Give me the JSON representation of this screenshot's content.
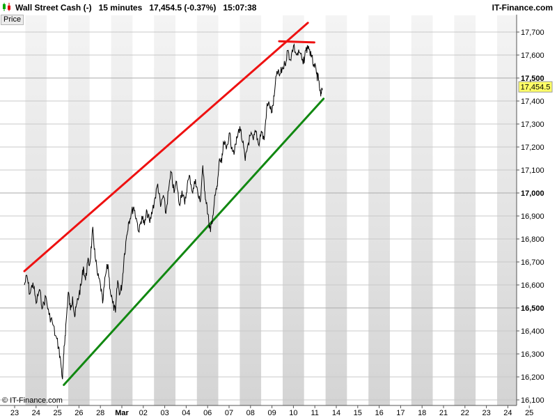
{
  "header": {
    "instrument": "Wall Street Cash (-)",
    "timeframe": "15 minutes",
    "last_change": "17,454.5 (-0.37%)",
    "time": "15:07:38",
    "brand": "IT-Finance.com"
  },
  "panel_label": "Price",
  "copyright": "© IT-Finance.com",
  "last_price_label": "17,454.5",
  "colors": {
    "price_line": "#000000",
    "resistance": "#ee1111",
    "support": "#118811",
    "band_a": "#ffffff",
    "band_b": "#d4d4d4",
    "grid": "#c8c8c8"
  },
  "chart_data": {
    "type": "line",
    "title": "Wall Street Cash (-)",
    "ylim": [
      16100,
      17750
    ],
    "y_ticks": [
      {
        "value": 16100,
        "label": "16,100",
        "bold": false
      },
      {
        "value": 16200,
        "label": "16,200",
        "bold": false
      },
      {
        "value": 16300,
        "label": "16,300",
        "bold": false
      },
      {
        "value": 16400,
        "label": "16,400",
        "bold": false
      },
      {
        "value": 16500,
        "label": "16,500",
        "bold": true
      },
      {
        "value": 16600,
        "label": "16,600",
        "bold": false
      },
      {
        "value": 16700,
        "label": "16,700",
        "bold": false
      },
      {
        "value": 16800,
        "label": "16,800",
        "bold": false
      },
      {
        "value": 16900,
        "label": "16,900",
        "bold": false
      },
      {
        "value": 17000,
        "label": "17,000",
        "bold": true
      },
      {
        "value": 17100,
        "label": "17,100",
        "bold": false
      },
      {
        "value": 17200,
        "label": "17,200",
        "bold": false
      },
      {
        "value": 17300,
        "label": "17,300",
        "bold": false
      },
      {
        "value": 17400,
        "label": "17,400",
        "bold": false
      },
      {
        "value": 17500,
        "label": "17,500",
        "bold": true
      },
      {
        "value": 17600,
        "label": "17,600",
        "bold": false
      },
      {
        "value": 17700,
        "label": "17,700",
        "bold": false
      }
    ],
    "x_ticks": [
      {
        "index": 0,
        "label": "23",
        "bold": false
      },
      {
        "index": 1,
        "label": "24",
        "bold": false
      },
      {
        "index": 2,
        "label": "25",
        "bold": false
      },
      {
        "index": 3,
        "label": "26",
        "bold": false
      },
      {
        "index": 4,
        "label": "28",
        "bold": false
      },
      {
        "index": 5,
        "label": "Mar",
        "bold": true
      },
      {
        "index": 6,
        "label": "02",
        "bold": false
      },
      {
        "index": 7,
        "label": "03",
        "bold": false
      },
      {
        "index": 8,
        "label": "04",
        "bold": false
      },
      {
        "index": 9,
        "label": "06",
        "bold": false
      },
      {
        "index": 10,
        "label": "07",
        "bold": false
      },
      {
        "index": 11,
        "label": "08",
        "bold": false
      },
      {
        "index": 12,
        "label": "09",
        "bold": false
      },
      {
        "index": 13,
        "label": "10",
        "bold": false
      },
      {
        "index": 14,
        "label": "11",
        "bold": false
      },
      {
        "index": 15,
        "label": "14",
        "bold": false
      },
      {
        "index": 16,
        "label": "15",
        "bold": false
      },
      {
        "index": 17,
        "label": "16",
        "bold": false
      },
      {
        "index": 18,
        "label": "17",
        "bold": false
      },
      {
        "index": 19,
        "label": "18",
        "bold": false
      },
      {
        "index": 20,
        "label": "21",
        "bold": false
      },
      {
        "index": 21,
        "label": "22",
        "bold": false
      },
      {
        "index": 22,
        "label": "23",
        "bold": false
      },
      {
        "index": 23,
        "label": "24",
        "bold": false
      },
      {
        "index": 24,
        "label": "25",
        "bold": false
      }
    ],
    "series": [
      {
        "values": [
          [
            0.0,
            16600
          ],
          [
            0.12,
            16640
          ],
          [
            0.25,
            16560
          ],
          [
            0.4,
            16610
          ],
          [
            0.55,
            16520
          ],
          [
            0.7,
            16580
          ],
          [
            0.85,
            16500
          ],
          [
            1.0,
            16550
          ],
          [
            1.15,
            16470
          ],
          [
            1.3,
            16440
          ],
          [
            1.45,
            16380
          ],
          [
            1.6,
            16330
          ],
          [
            1.7,
            16260
          ],
          [
            1.78,
            16190
          ],
          [
            1.84,
            16300
          ],
          [
            1.9,
            16380
          ],
          [
            1.98,
            16480
          ],
          [
            2.05,
            16570
          ],
          [
            2.15,
            16490
          ],
          [
            2.25,
            16550
          ],
          [
            2.35,
            16460
          ],
          [
            2.45,
            16520
          ],
          [
            2.55,
            16560
          ],
          [
            2.65,
            16600
          ],
          [
            2.75,
            16680
          ],
          [
            2.85,
            16620
          ],
          [
            2.95,
            16700
          ],
          [
            3.05,
            16690
          ],
          [
            3.15,
            16800
          ],
          [
            3.2,
            16840
          ],
          [
            3.3,
            16720
          ],
          [
            3.42,
            16640
          ],
          [
            3.55,
            16600
          ],
          [
            3.65,
            16520
          ],
          [
            3.78,
            16640
          ],
          [
            3.9,
            16690
          ],
          [
            4.0,
            16580
          ],
          [
            4.12,
            16520
          ],
          [
            4.25,
            16480
          ],
          [
            4.35,
            16620
          ],
          [
            4.45,
            16560
          ],
          [
            4.55,
            16600
          ],
          [
            4.65,
            16720
          ],
          [
            4.75,
            16800
          ],
          [
            4.85,
            16870
          ],
          [
            4.98,
            16910
          ],
          [
            5.1,
            16940
          ],
          [
            5.22,
            16890
          ],
          [
            5.35,
            16830
          ],
          [
            5.48,
            16900
          ],
          [
            5.6,
            16860
          ],
          [
            5.72,
            16920
          ],
          [
            5.85,
            16870
          ],
          [
            5.98,
            16930
          ],
          [
            6.1,
            16980
          ],
          [
            6.22,
            17040
          ],
          [
            6.35,
            16940
          ],
          [
            6.48,
            16990
          ],
          [
            6.6,
            16910
          ],
          [
            6.72,
            17010
          ],
          [
            6.85,
            17090
          ],
          [
            6.98,
            17000
          ],
          [
            7.1,
            17050
          ],
          [
            7.22,
            16950
          ],
          [
            7.35,
            17010
          ],
          [
            7.48,
            16950
          ],
          [
            7.6,
            17040
          ],
          [
            7.72,
            17070
          ],
          [
            7.85,
            17000
          ],
          [
            7.98,
            17060
          ],
          [
            8.1,
            16990
          ],
          [
            8.2,
            16960
          ],
          [
            8.32,
            17120
          ],
          [
            8.4,
            17010
          ],
          [
            8.5,
            16960
          ],
          [
            8.6,
            16870
          ],
          [
            8.68,
            16830
          ],
          [
            8.78,
            16900
          ],
          [
            8.9,
            16990
          ],
          [
            9.0,
            17030
          ],
          [
            9.1,
            17150
          ],
          [
            9.2,
            17130
          ],
          [
            9.3,
            17220
          ],
          [
            9.42,
            17190
          ],
          [
            9.55,
            17260
          ],
          [
            9.68,
            17200
          ],
          [
            9.8,
            17180
          ],
          [
            9.92,
            17240
          ],
          [
            10.05,
            17290
          ],
          [
            10.18,
            17220
          ],
          [
            10.3,
            17140
          ],
          [
            10.42,
            17210
          ],
          [
            10.55,
            17250
          ],
          [
            10.68,
            17230
          ],
          [
            10.8,
            17270
          ],
          [
            10.92,
            17210
          ],
          [
            11.05,
            17270
          ],
          [
            11.18,
            17230
          ],
          [
            11.3,
            17370
          ],
          [
            11.42,
            17390
          ],
          [
            11.55,
            17350
          ],
          [
            11.65,
            17420
          ],
          [
            11.78,
            17530
          ],
          [
            11.9,
            17510
          ],
          [
            12.02,
            17540
          ],
          [
            12.15,
            17560
          ],
          [
            12.28,
            17620
          ],
          [
            12.4,
            17580
          ],
          [
            12.55,
            17640
          ],
          [
            12.7,
            17600
          ],
          [
            12.85,
            17610
          ],
          [
            13.0,
            17560
          ],
          [
            13.12,
            17620
          ],
          [
            13.25,
            17640
          ],
          [
            13.38,
            17590
          ],
          [
            13.5,
            17560
          ],
          [
            13.62,
            17520
          ],
          [
            13.72,
            17490
          ],
          [
            13.82,
            17420
          ],
          [
            13.9,
            17454
          ]
        ]
      }
    ],
    "trendlines": [
      {
        "name": "resistance",
        "from": [
          0.0,
          16660
        ],
        "to": [
          13.22,
          17740
        ]
      },
      {
        "name": "resistance-top",
        "from": [
          11.88,
          17660
        ],
        "to": [
          13.52,
          17655
        ]
      },
      {
        "name": "support",
        "from": [
          1.84,
          16165
        ],
        "to": [
          13.95,
          17410
        ]
      }
    ]
  }
}
